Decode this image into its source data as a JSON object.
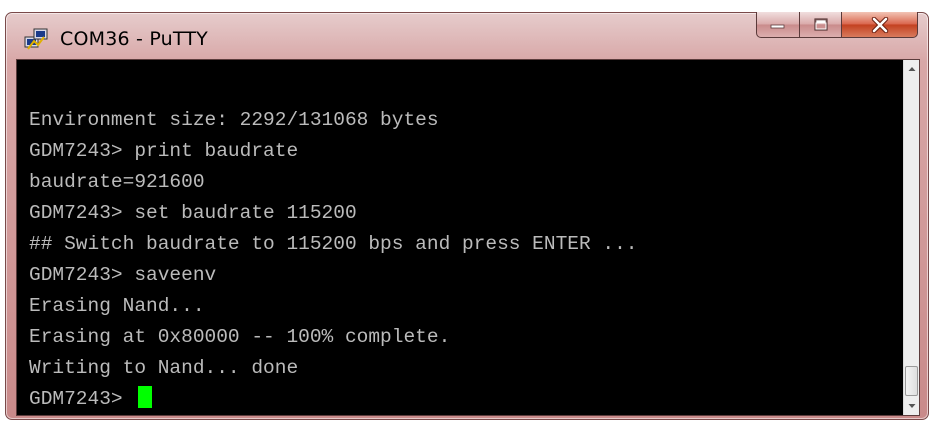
{
  "window": {
    "title": "COM36 - PuTTY"
  },
  "controls": {
    "minimize_icon": "minimize-icon",
    "maximize_icon": "maximize-icon",
    "close_icon": "close-icon"
  },
  "terminal": {
    "lines": [
      "",
      "Environment size: 2292/131068 bytes",
      "GDM7243> print baudrate",
      "baudrate=921600",
      "GDM7243> set baudrate 115200",
      "## Switch baudrate to 115200 bps and press ENTER ...",
      "GDM7243> saveenv",
      "Erasing Nand...",
      "Erasing at 0x80000 -- 100% complete.",
      "Writing to Nand... done",
      "GDM7243> "
    ],
    "text_color": "#bbbbbb",
    "background_color": "#000000",
    "cursor_color": "#00ff00"
  },
  "colors": {
    "titlebar": "#d8a7a7",
    "close_button": "#c2401f"
  }
}
